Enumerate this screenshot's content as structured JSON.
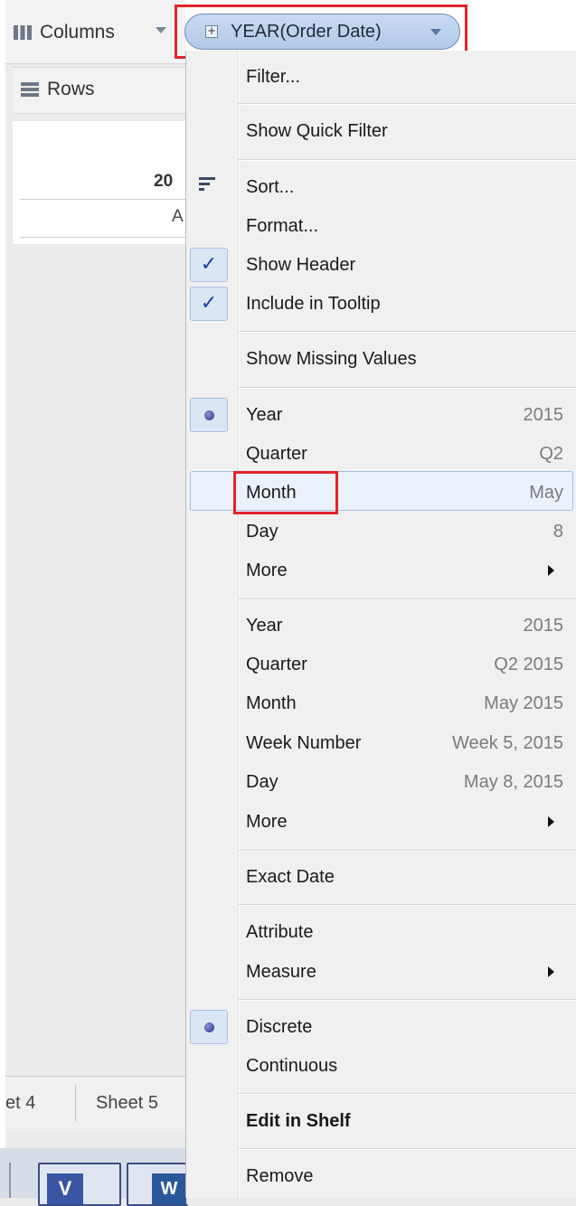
{
  "columns_shelf": {
    "label": "Columns",
    "icon": "columns-icon",
    "pill_label": "YEAR(Order Date)"
  },
  "rows_shelf": {
    "label": "Rows",
    "icon": "rows-icon"
  },
  "view": {
    "header_year": "20",
    "header_sub": "A"
  },
  "sheet_tabs": [
    "et 4",
    "Sheet 5"
  ],
  "taskbar": {
    "visio_letter": "V",
    "word_letter": "W"
  },
  "menu": {
    "filter": "Filter...",
    "show_quick_filter": "Show Quick Filter",
    "sort": "Sort...",
    "format": "Format...",
    "show_header": "Show Header",
    "include_in_tooltip": "Include in Tooltip",
    "show_missing_values": "Show Missing Values",
    "date_part": [
      {
        "label": "Year",
        "value": "2015"
      },
      {
        "label": "Quarter",
        "value": "Q2"
      },
      {
        "label": "Month",
        "value": "May"
      },
      {
        "label": "Day",
        "value": "8"
      },
      {
        "label": "More",
        "value": ""
      }
    ],
    "date_value": [
      {
        "label": "Year",
        "value": "2015"
      },
      {
        "label": "Quarter",
        "value": "Q2 2015"
      },
      {
        "label": "Month",
        "value": "May 2015"
      },
      {
        "label": "Week Number",
        "value": "Week 5, 2015"
      },
      {
        "label": "Day",
        "value": "May 8, 2015"
      },
      {
        "label": "More",
        "value": ""
      }
    ],
    "exact_date": "Exact Date",
    "attribute": "Attribute",
    "measure": "Measure",
    "discrete": "Discrete",
    "continuous": "Continuous",
    "edit_in_shelf": "Edit in Shelf",
    "remove": "Remove"
  },
  "icons": {
    "checkmark": "✓"
  },
  "colors": {
    "highlight_border": "#e0242b",
    "pill_blue": "#b3c9e8"
  }
}
